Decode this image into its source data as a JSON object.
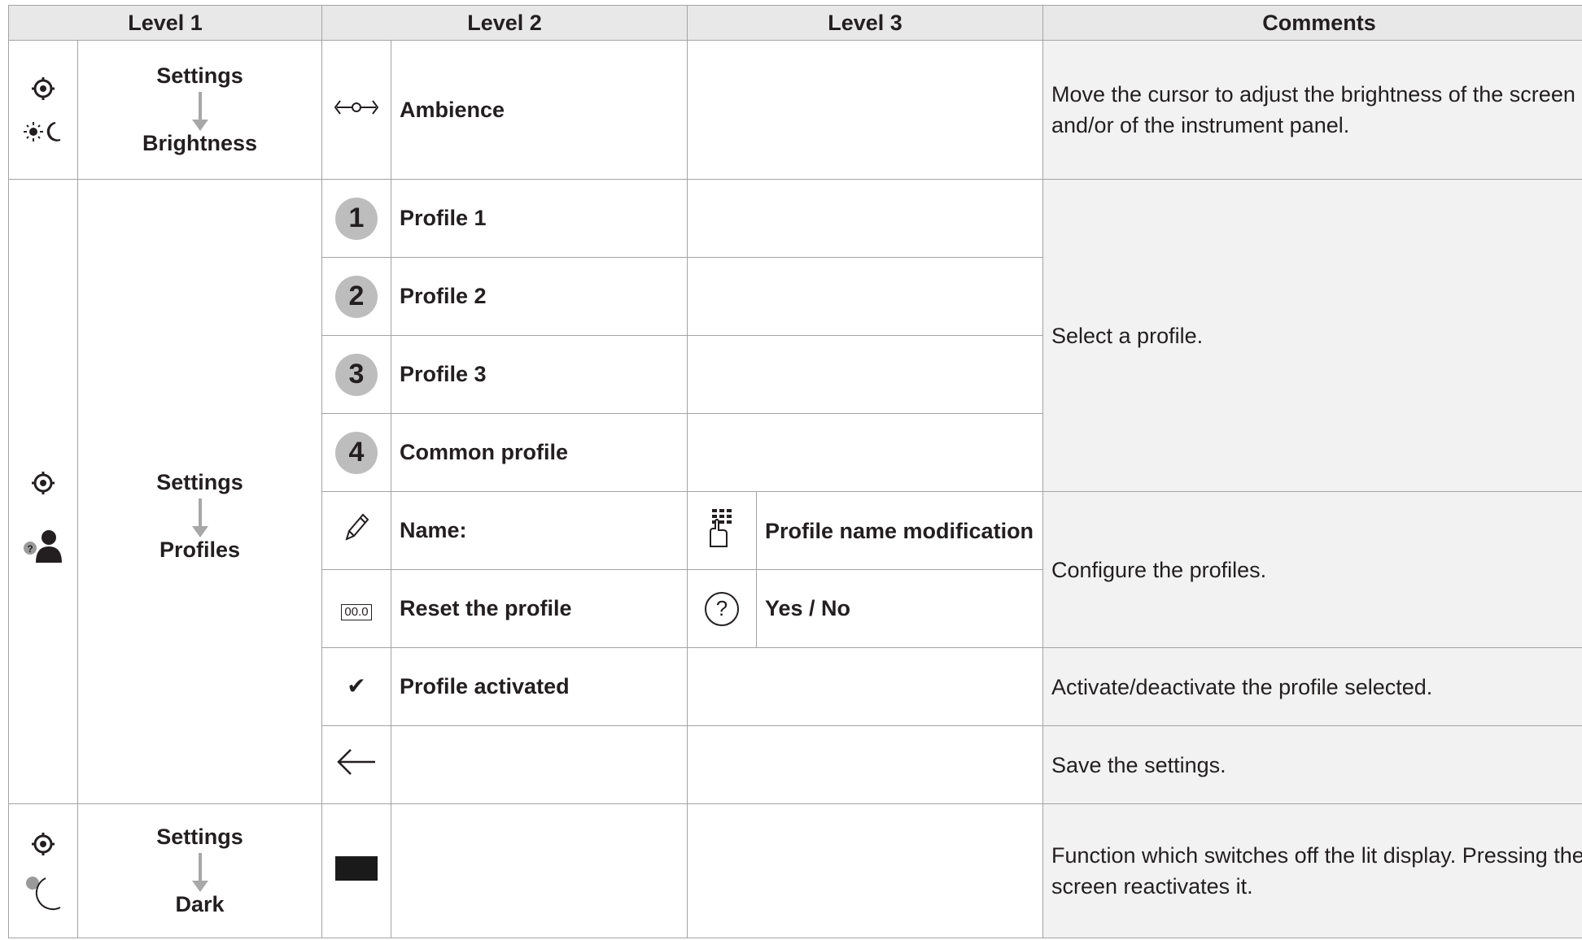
{
  "headers": {
    "level1": "Level 1",
    "level2": "Level 2",
    "level3": "Level 3",
    "comments": "Comments"
  },
  "rows": {
    "ambience": {
      "level1_top": "Settings",
      "level1_bottom": "Brightness",
      "level2": "Ambience",
      "comment": "Move the cursor to adjust the brightness of the screen and/or of the instrument panel."
    },
    "profiles": {
      "level1_top": "Settings",
      "level1_bottom": "Profiles",
      "items": [
        {
          "badge": "1",
          "label": "Profile 1"
        },
        {
          "badge": "2",
          "label": "Profile 2"
        },
        {
          "badge": "3",
          "label": "Profile 3"
        },
        {
          "badge": "4",
          "label": "Common profile"
        }
      ],
      "select_comment": "Select a profile.",
      "name_label": "Name:",
      "name_level3": "Profile name modification",
      "reset_label": "Reset the profile",
      "reset_icon_text": "00.0",
      "reset_level3": "Yes / No",
      "configure_comment": "Configure the profiles.",
      "activated_label": "Profile activated",
      "activated_comment": "Activate/deactivate the profile selected.",
      "save_comment": "Save the settings."
    },
    "dark": {
      "level1_top": "Settings",
      "level1_bottom": "Dark",
      "comment": "Function which switches off the lit display. Pressing the screen reactivates it."
    }
  },
  "icons": [
    "gear-icon",
    "sun-moon-icon",
    "slider-icon",
    "profile-user-icon",
    "pencil-icon",
    "keypad-icon",
    "question-icon",
    "checkmark-icon",
    "back-arrow-icon",
    "moon-icon",
    "black-screen-icon"
  ]
}
